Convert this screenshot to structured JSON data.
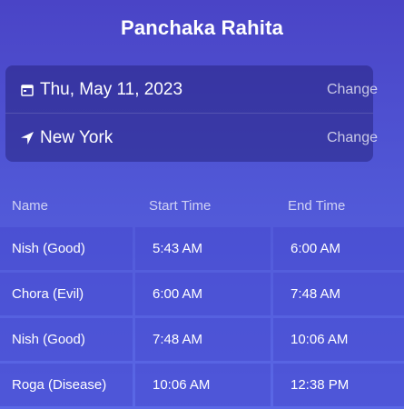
{
  "title": "Panchaka Rahita",
  "settings": {
    "date": {
      "icon": "calendar-icon",
      "value": "Thu, May 11, 2023",
      "action": "Change"
    },
    "location": {
      "icon": "location-arrow-icon",
      "value": "New York",
      "action": "Change"
    }
  },
  "table": {
    "headers": [
      "Name",
      "Start Time",
      "End Time"
    ],
    "rows": [
      {
        "name": "Nish (Good)",
        "start": "5:43 AM",
        "end": "6:00 AM"
      },
      {
        "name": "Chora (Evil)",
        "start": "6:00 AM",
        "end": "7:48 AM"
      },
      {
        "name": "Nish (Good)",
        "start": "7:48 AM",
        "end": "10:06 AM"
      },
      {
        "name": "Roga (Disease)",
        "start": "10:06 AM",
        "end": "12:38 PM"
      }
    ]
  }
}
